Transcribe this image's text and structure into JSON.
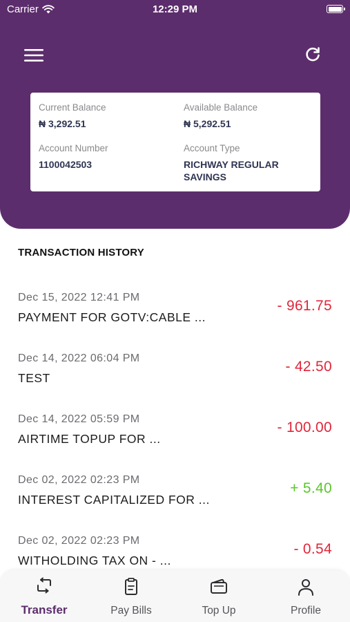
{
  "status_bar": {
    "carrier": "Carrier",
    "time": "12:29 PM"
  },
  "header": {
    "menu_icon": "hamburger-menu-icon",
    "refresh_icon": "refresh-icon",
    "background_color": "#5c2d6c"
  },
  "account": {
    "current_balance_label": "Current Balance",
    "current_balance_value": "₦ 3,292.51",
    "available_balance_label": "Available Balance",
    "available_balance_value": "₦ 5,292.51",
    "account_number_label": "Account Number",
    "account_number_value": "1100042503",
    "account_type_label": "Account Type",
    "account_type_value": "RICHWAY REGULAR SAVINGS"
  },
  "transactions": {
    "title": "TRANSACTION HISTORY",
    "items": [
      {
        "date": "Dec 15, 2022 12:41 PM",
        "description": "PAYMENT FOR GOTV:CABLE ...",
        "amount": "- 961.75",
        "type": "debit"
      },
      {
        "date": "Dec 14, 2022 06:04 PM",
        "description": "TEST",
        "amount": "- 42.50",
        "type": "debit"
      },
      {
        "date": "Dec 14, 2022 05:59 PM",
        "description": "AIRTIME TOPUP FOR ...",
        "amount": "- 100.00",
        "type": "debit"
      },
      {
        "date": "Dec 02, 2022 02:23 PM",
        "description": "INTEREST CAPITALIZED FOR ...",
        "amount": "+ 5.40",
        "type": "credit"
      },
      {
        "date": "Dec 02, 2022 02:23 PM",
        "description": "WITHOLDING TAX ON - ...",
        "amount": "- 0.54",
        "type": "debit"
      }
    ],
    "debit_color": "#e0263a",
    "credit_color": "#5ac72a"
  },
  "tab_bar": {
    "items": [
      {
        "label": "Transfer",
        "icon": "transfer-icon",
        "active": true
      },
      {
        "label": "Pay Bills",
        "icon": "clipboard-icon",
        "active": false
      },
      {
        "label": "Top Up",
        "icon": "wallet-icon",
        "active": false
      },
      {
        "label": "Profile",
        "icon": "user-icon",
        "active": false
      }
    ],
    "active_color": "#5c2d6c"
  }
}
